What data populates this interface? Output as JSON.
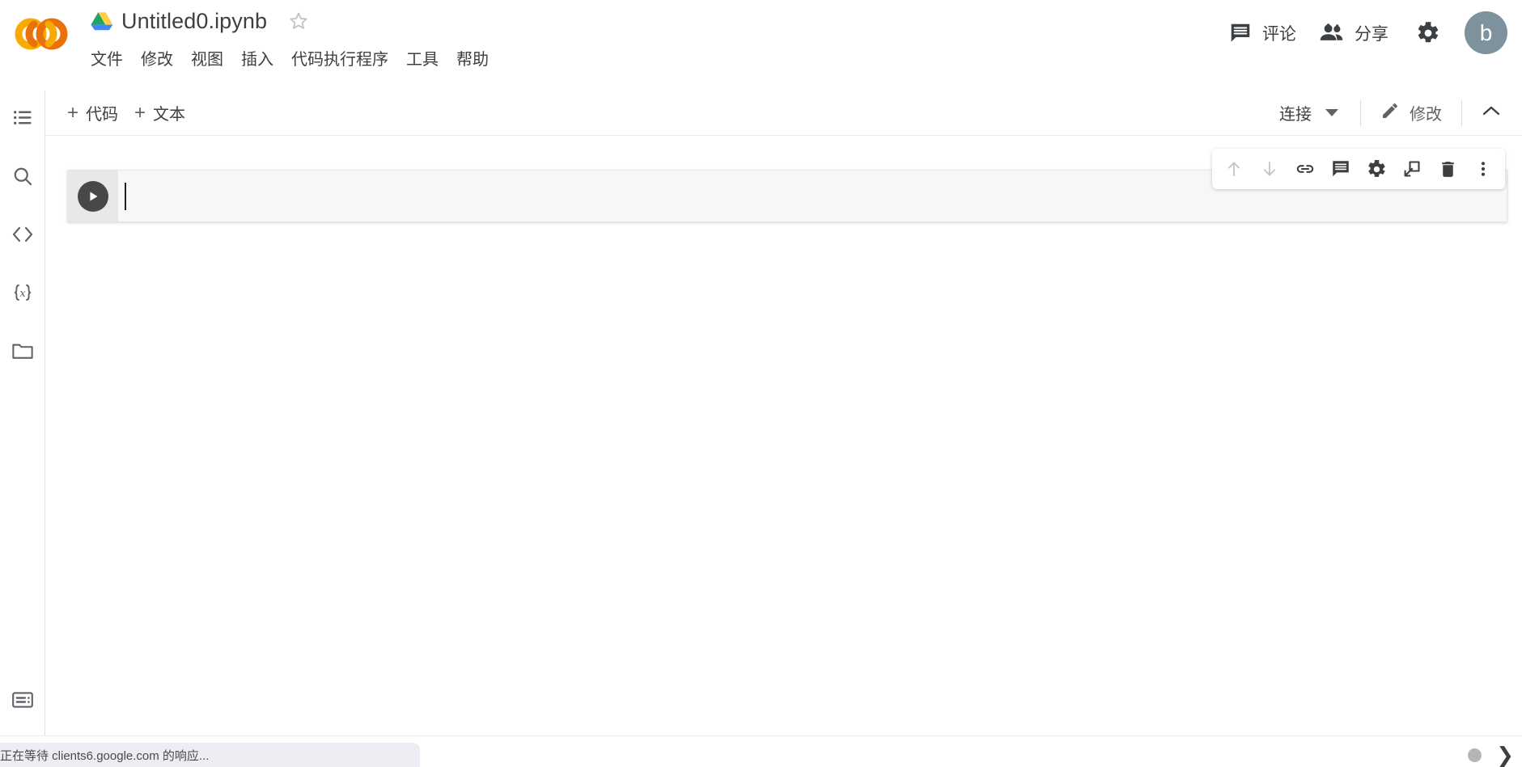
{
  "header": {
    "logo": "colab-logo",
    "drive_icon": "google-drive-icon",
    "document_title": "Untitled0.ipynb",
    "star_icon": "star-outline-icon",
    "menu_items": [
      {
        "label": "文件",
        "name": "menu-file"
      },
      {
        "label": "修改",
        "name": "menu-edit"
      },
      {
        "label": "视图",
        "name": "menu-view"
      },
      {
        "label": "插入",
        "name": "menu-insert"
      },
      {
        "label": "代码执行程序",
        "name": "menu-runtime"
      },
      {
        "label": "工具",
        "name": "menu-tools"
      },
      {
        "label": "帮助",
        "name": "menu-help"
      }
    ],
    "comment_label": "评论",
    "comment_icon": "comment-icon",
    "share_label": "分享",
    "share_icon": "people-icon",
    "settings_icon": "gear-icon",
    "avatar_letter": "b",
    "avatar_color": "#7d929d"
  },
  "sidebar": {
    "items": [
      {
        "name": "sidebar-item-table-of-contents",
        "icon": "list-icon"
      },
      {
        "name": "sidebar-item-search",
        "icon": "search-icon"
      },
      {
        "name": "sidebar-item-code-snippets",
        "icon": "code-brackets-icon"
      },
      {
        "name": "sidebar-item-variables",
        "icon": "variables-braces-icon"
      },
      {
        "name": "sidebar-item-files",
        "icon": "folder-icon"
      }
    ],
    "bottom_item": {
      "name": "sidebar-item-terminal",
      "icon": "terminal-icon"
    }
  },
  "toolbar": {
    "add_code_label": "代码",
    "add_text_label": "文本",
    "plus_glyph": "+",
    "connect_label": "连接",
    "connect_caret_icon": "chevron-down-icon",
    "edit_label": "修改",
    "edit_icon": "pencil-icon",
    "collapse_icon": "chevron-up-icon"
  },
  "notebook": {
    "cell": {
      "run_icon": "play-icon",
      "code_value": "",
      "code_placeholder": "",
      "toolbar_buttons": [
        {
          "name": "cell-move-up-button",
          "icon": "arrow-up-icon",
          "disabled": true
        },
        {
          "name": "cell-move-down-button",
          "icon": "arrow-down-icon",
          "disabled": true
        },
        {
          "name": "cell-link-button",
          "icon": "link-icon",
          "disabled": false
        },
        {
          "name": "cell-comment-button",
          "icon": "comment-icon",
          "disabled": false
        },
        {
          "name": "cell-settings-button",
          "icon": "gear-icon",
          "disabled": false
        },
        {
          "name": "cell-mirror-button",
          "icon": "open-in-new-icon",
          "disabled": false
        },
        {
          "name": "cell-delete-button",
          "icon": "trash-icon",
          "disabled": false
        },
        {
          "name": "cell-more-button",
          "icon": "more-vertical-icon",
          "disabled": false
        }
      ]
    }
  },
  "statusbar": {
    "message": "正在等待 clients6.google.com 的响应...",
    "dot_icon": "loading-dot-icon",
    "expand_icon": "chevron-right-icon"
  }
}
